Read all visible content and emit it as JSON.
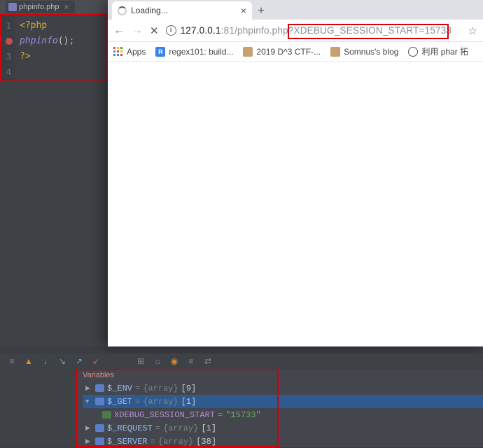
{
  "editor": {
    "tab_name": "phpinfo.php",
    "lines": [
      "1",
      "2",
      "3",
      "4"
    ],
    "l1_open": "<?php",
    "l2_func": "phpinfo",
    "l2_parens": "()",
    "l2_semi": ";",
    "l3_close": "?>"
  },
  "browser": {
    "tab_title": "Loading...",
    "url_host": "127.0.0.1",
    "url_port": ":81",
    "url_path": "/phpinfo.php",
    "url_query": "?XDEBUG_SESSION_START=15733",
    "bookmarks": {
      "apps": "Apps",
      "regex": "regex101: build...",
      "ctf": "2019 D^3 CTF-...",
      "somnus": "Somnus's blog",
      "phar": "利用 phar 拓"
    }
  },
  "debug": {
    "title": "Variables",
    "rows": {
      "env_name": "$_ENV",
      "env_type": "{array}",
      "env_count": "[9]",
      "get_name": "$_GET",
      "get_type": "{array}",
      "get_count": "[1]",
      "key_name": "XDEBUG_SESSION_START",
      "key_val": "\"15733\"",
      "req_name": "$_REQUEST",
      "req_type": "{array}",
      "req_count": "[1]",
      "srv_name": "$_SERVER",
      "srv_type": "{array}",
      "srv_count": "[38]"
    }
  }
}
